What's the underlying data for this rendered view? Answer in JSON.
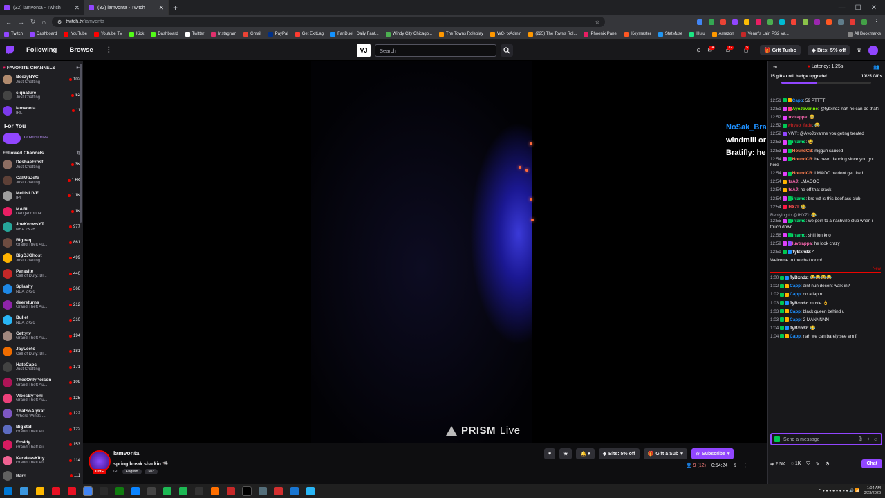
{
  "browser": {
    "tabs": [
      {
        "label": "(32) iamvonta - Twitch",
        "active": false
      },
      {
        "label": "(32) iamvonta - Twitch",
        "active": true
      }
    ],
    "url_domain": "twitch.tv",
    "url_path": "/iamvonta",
    "bookmarks": [
      "Twitch",
      "Dashboard",
      "YouTube",
      "Youtube TV",
      "Kick",
      "Dashboard",
      "Twitter",
      "Instagram",
      "Gmail",
      "PayPal",
      "Get ExitLag",
      "FanDuel | Daily Fant...",
      "Windy City Chicago...",
      "The Towns Roleplay",
      "WC- txAdmin",
      "(225) The Towns Rol...",
      "Phoenix Panel",
      "Keymaster",
      "StatMuse",
      "Hulu",
      "Amazon",
      "Venm's Lair: PS2 Va..."
    ],
    "all_bookmarks": "All Bookmarks"
  },
  "topnav": {
    "following": "Following",
    "browse": "Browse",
    "search_placeholder": "Search",
    "vj_logo": "VJ",
    "inbox_count": "14",
    "notif_count": "32",
    "whisper_count": "5",
    "gift_turbo": "Gift Turbo",
    "bits": "Bits: 5% off"
  },
  "sidebar": {
    "favorites_header": "FAVORITE CHANNELS",
    "favorites": [
      {
        "name": "BeezyNYC",
        "category": "Just Chatting",
        "viewers": "102"
      },
      {
        "name": "ciqnature",
        "category": "Just Chatting",
        "viewers": "52"
      },
      {
        "name": "iamvonta",
        "category": "IRL",
        "viewers": "11"
      }
    ],
    "for_you": "For You",
    "open_stories": "Open stories",
    "followed_header": "Followed Channels",
    "followed": [
      {
        "name": "DeshaeFrost",
        "category": "Just Chatting",
        "viewers": "3K"
      },
      {
        "name": "CallUpJefe",
        "category": "Just Chatting",
        "viewers": "1.6K"
      },
      {
        "name": "MeltisLIVE",
        "category": "IRL",
        "viewers": "1.1K"
      },
      {
        "name": "MARI",
        "category": "Danganronpa: ...",
        "viewers": "1K"
      },
      {
        "name": "JoeKnowsYT",
        "category": "NBA 2K26",
        "viewers": "977"
      },
      {
        "name": "BigIraq",
        "category": "Grand Theft Au...",
        "viewers": "861"
      },
      {
        "name": "BigDJGhost",
        "category": "Just Chatting",
        "viewers": "499"
      },
      {
        "name": "Parasite",
        "category": "Call of Duty: Bl...",
        "viewers": "440"
      },
      {
        "name": "Splashy",
        "category": "NBA 2K26",
        "viewers": "366"
      },
      {
        "name": "deereturns",
        "category": "Grand Theft Au...",
        "viewers": "212"
      },
      {
        "name": "Bullet",
        "category": "NBA 2K26",
        "viewers": "210"
      },
      {
        "name": "Cettytv",
        "category": "Grand Theft Au...",
        "viewers": "194"
      },
      {
        "name": "JayLeeto",
        "category": "Call of Duty: Bl...",
        "viewers": "181"
      },
      {
        "name": "HateCaps",
        "category": "Just Chatting",
        "viewers": "171"
      },
      {
        "name": "TheeOnlyPoison",
        "category": "Grand Theft Au...",
        "viewers": "109"
      },
      {
        "name": "VibesByToni",
        "category": "Grand Theft Au...",
        "viewers": "125"
      },
      {
        "name": "ThatSoAlykat",
        "category": "Where Winds ...",
        "viewers": "122"
      },
      {
        "name": "BigStall",
        "category": "Grand Theft Au...",
        "viewers": "122"
      },
      {
        "name": "Fosidy",
        "category": "Grand Theft Au...",
        "viewers": "153"
      },
      {
        "name": "KarelessKitty",
        "category": "Grand Theft Au...",
        "viewers": "114"
      },
      {
        "name": "Rarri",
        "category": "",
        "viewers": "111"
      }
    ]
  },
  "player": {
    "watermark": "PRISM",
    "watermark_suffix": "Live",
    "overlay_chat": [
      {
        "user": "NoSak_Brax",
        "text": ": tell this nigga to go do a windmill or sum"
      },
      {
        "user": "Bratifly",
        "text": ": he want latto"
      }
    ]
  },
  "channel": {
    "name": "iamvonta",
    "live": "LIVE",
    "title": "spring break sharkin",
    "tags": [
      "IRL",
      "English",
      "302"
    ],
    "bits": "Bits: 5% off",
    "gift_sub": "Gift a Sub",
    "subscribe": "Subscribe",
    "viewers": "9 (12)",
    "uptime": "0:54:24"
  },
  "chat": {
    "latency": "Latency: 1.25s",
    "gift_progress": "15 gifts until badge upgrade!",
    "gift_count": "10/25 Gifts",
    "messages": [
      {
        "time": "12:51",
        "user": "Capp",
        "color": "#1e90ff",
        "text": ": 59 PTTTT"
      },
      {
        "time": "12:51",
        "user": "AyoJovanne",
        "color": "#7fff00",
        "text": ": @tybxndz nah he can do that?"
      },
      {
        "time": "12:52",
        "user": "luvtrappa",
        "color": "#ff69b4",
        "text": ": 😂"
      },
      {
        "time": "12:52",
        "user": "whyso_fade",
        "color": "#b22222",
        "text": ": 😂"
      },
      {
        "time": "12:52",
        "user": "NWT",
        "color": "#adadb8",
        "text": ": @AyoJovanne you geting treated"
      },
      {
        "time": "12:53",
        "user": "irramo",
        "color": "#00ff7f",
        "text": ": 😂"
      },
      {
        "time": "12:53",
        "user": "HoundCB",
        "color": "#ff7f50",
        "text": ": nigguh sauced"
      },
      {
        "time": "12:54",
        "user": "HoundCB",
        "color": "#ff7f50",
        "text": ": he been dancing since you got here"
      },
      {
        "time": "12:54",
        "user": "HoundCB",
        "color": "#ff7f50",
        "text": ": LMAOO he dont get tired"
      },
      {
        "time": "12:54",
        "user": "itsAJ",
        "color": "#ff69b4",
        "text": ": LMAOOO"
      },
      {
        "time": "12:54",
        "user": "itsAJ",
        "color": "#ff69b4",
        "text": ": he off that crack"
      },
      {
        "time": "12:54",
        "user": "irramo",
        "color": "#00ff7f",
        "text": ": bro wtf is this boof ass club"
      },
      {
        "time": "12:54",
        "user": "IHXZI",
        "color": "#ff4f4f",
        "text": ": 😂"
      },
      {
        "time": "",
        "user": "",
        "color": "#adadb8",
        "text": "Replying to @IHXZI: 😂"
      },
      {
        "time": "12:55",
        "user": "irramo",
        "color": "#00ff7f",
        "text": ": we goin to a nashville club when i touch down"
      },
      {
        "time": "12:56",
        "user": "irramo",
        "color": "#00ff7f",
        "text": ": shiii ion kno"
      },
      {
        "time": "12:59",
        "user": "luvtrappa",
        "color": "#ff69b4",
        "text": ": he look crazy"
      },
      {
        "time": "12:59",
        "user": "TyBxndz",
        "color": "#efeff1",
        "text": ": ^"
      },
      {
        "time": "",
        "user": "",
        "color": "#efeff1",
        "text": "Welcome to the chat room!"
      }
    ],
    "new_label": "New",
    "new_messages": [
      {
        "time": "1:00",
        "user": "TyBxndz",
        "color": "#efeff1",
        "text": ": 😂😂😂😂"
      },
      {
        "time": "1:02",
        "user": "Capp",
        "color": "#1e90ff",
        "text": ": aint nun decent walk in?"
      },
      {
        "time": "1:02",
        "user": "Capp",
        "color": "#1e90ff",
        "text": ": do a lap rq"
      },
      {
        "time": "1:03",
        "user": "TyBxndz",
        "color": "#efeff1",
        "text": ": movie 👌"
      },
      {
        "time": "1:03",
        "user": "Capp",
        "color": "#1e90ff",
        "text": ": black queen behind u"
      },
      {
        "time": "1:03",
        "user": "Capp",
        "color": "#1e90ff",
        "text": ": 2 MANNNNN"
      },
      {
        "time": "1:04",
        "user": "TyBxndz",
        "color": "#efeff1",
        "text": ": 😂"
      },
      {
        "time": "1:04",
        "user": "Capp",
        "color": "#1e90ff",
        "text": ": nah we can barely see em fr"
      }
    ],
    "input_placeholder": "Send a message",
    "points": "2.5K",
    "points2": "1K",
    "chat_button": "Chat"
  },
  "taskbar": {
    "time": "1:04 AM",
    "date": "3/23/2026"
  },
  "colors": {
    "twitch_purple": "#9146ff",
    "live_red": "#eb0400"
  }
}
